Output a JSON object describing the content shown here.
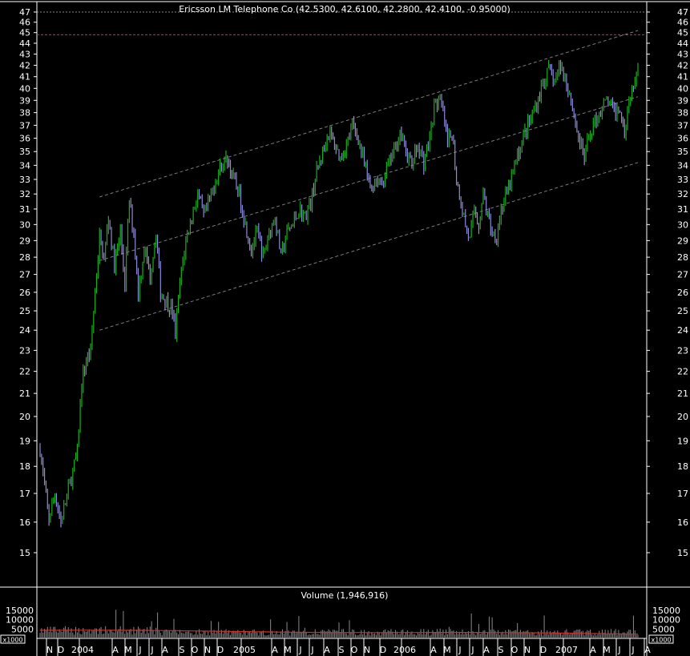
{
  "chart_data": {
    "type": "ohlc",
    "title": "Ericsson LM Telephone Co (42.5300, 42.6100, 42.2800, 42.4100, -0.95000)",
    "volume_title": "Volume (1,946,916)",
    "volume_unit_label": "x1000",
    "ylim": [
      14,
      47.5
    ],
    "y_ticks": [
      15,
      16,
      17,
      18,
      19,
      20,
      21,
      22,
      23,
      24,
      25,
      26,
      27,
      28,
      29,
      30,
      31,
      32,
      33,
      34,
      35,
      36,
      37,
      38,
      39,
      40,
      41,
      42,
      43,
      44,
      45,
      46,
      47
    ],
    "volume_ylim": [
      0,
      20000
    ],
    "volume_ticks": [
      5000,
      10000,
      15000
    ],
    "grid": false,
    "x_labels": [
      "N",
      "D",
      "2004",
      "A",
      "M",
      "J",
      "J",
      "A",
      "S",
      "O",
      "N",
      "D",
      "2005",
      "A",
      "M",
      "J",
      "J",
      "A",
      "S",
      "O",
      "N",
      "D",
      "2006",
      "A",
      "M",
      "J",
      "J",
      "A",
      "S",
      "O",
      "N",
      "D",
      "2007",
      "A",
      "M",
      "J",
      "J",
      "A"
    ],
    "reference_line": 44.8,
    "price_path": [
      [
        0,
        18.7
      ],
      [
        3,
        17.2
      ],
      [
        6,
        16.1
      ],
      [
        10,
        17.0
      ],
      [
        14,
        16.0
      ],
      [
        18,
        16.9
      ],
      [
        22,
        17.8
      ],
      [
        25,
        18.5
      ],
      [
        28,
        21.5
      ],
      [
        31,
        22.5
      ],
      [
        34,
        23.0
      ],
      [
        37,
        26.0
      ],
      [
        40,
        29.2
      ],
      [
        43,
        27.8
      ],
      [
        46,
        30.5
      ],
      [
        50,
        27.5
      ],
      [
        54,
        29.5
      ],
      [
        57,
        26.5
      ],
      [
        60,
        31.5
      ],
      [
        63,
        29.5
      ],
      [
        66,
        26.0
      ],
      [
        70,
        28.5
      ],
      [
        74,
        27.0
      ],
      [
        78,
        29.5
      ],
      [
        81,
        26.0
      ],
      [
        85,
        25.5
      ],
      [
        89,
        25.0
      ],
      [
        91,
        23.8
      ],
      [
        94,
        26.5
      ],
      [
        98,
        29.0
      ],
      [
        102,
        30.5
      ],
      [
        106,
        32.0
      ],
      [
        110,
        30.5
      ],
      [
        114,
        31.5
      ],
      [
        118,
        33.0
      ],
      [
        122,
        34.0
      ],
      [
        126,
        34.5
      ],
      [
        130,
        33.0
      ],
      [
        134,
        32.0
      ],
      [
        138,
        30.0
      ],
      [
        142,
        28.5
      ],
      [
        146,
        29.5
      ],
      [
        150,
        28.0
      ],
      [
        154,
        29.5
      ],
      [
        158,
        30.5
      ],
      [
        162,
        28.0
      ],
      [
        166,
        29.5
      ],
      [
        170,
        30.0
      ],
      [
        174,
        31.0
      ],
      [
        178,
        30.5
      ],
      [
        182,
        31.5
      ],
      [
        186,
        33.5
      ],
      [
        190,
        35.0
      ],
      [
        194,
        36.5
      ],
      [
        198,
        35.5
      ],
      [
        202,
        34.5
      ],
      [
        206,
        35.5
      ],
      [
        210,
        37.0
      ],
      [
        214,
        36.0
      ],
      [
        218,
        34.0
      ],
      [
        222,
        32.5
      ],
      [
        226,
        33.0
      ],
      [
        230,
        32.8
      ],
      [
        234,
        34.0
      ],
      [
        238,
        35.0
      ],
      [
        242,
        36.5
      ],
      [
        246,
        35.0
      ],
      [
        250,
        34.0
      ],
      [
        254,
        35.5
      ],
      [
        258,
        34.2
      ],
      [
        262,
        36.0
      ],
      [
        265,
        38.5
      ],
      [
        268,
        39.0
      ],
      [
        271,
        38.0
      ],
      [
        274,
        35.5
      ],
      [
        277,
        36.5
      ],
      [
        280,
        33.0
      ],
      [
        283,
        31.5
      ],
      [
        286,
        30.0
      ],
      [
        289,
        29.0
      ],
      [
        292,
        31.0
      ],
      [
        295,
        30.0
      ],
      [
        298,
        32.0
      ],
      [
        301,
        30.5
      ],
      [
        304,
        29.5
      ],
      [
        307,
        29.3
      ],
      [
        310,
        31.0
      ],
      [
        314,
        32.0
      ],
      [
        318,
        33.5
      ],
      [
        322,
        35.0
      ],
      [
        326,
        36.5
      ],
      [
        330,
        37.5
      ],
      [
        334,
        38.8
      ],
      [
        338,
        40.5
      ],
      [
        342,
        41.5
      ],
      [
        346,
        40.5
      ],
      [
        350,
        42.0
      ],
      [
        354,
        40.5
      ],
      [
        358,
        38.5
      ],
      [
        362,
        36.0
      ],
      [
        366,
        34.5
      ],
      [
        370,
        36.5
      ],
      [
        374,
        37.5
      ],
      [
        378,
        38.5
      ],
      [
        382,
        39.0
      ],
      [
        386,
        38.0
      ],
      [
        390,
        38.5
      ],
      [
        393,
        36.5
      ],
      [
        396,
        39.0
      ],
      [
        399,
        40.5
      ],
      [
        402,
        42.4
      ]
    ],
    "channel": {
      "upper": [
        [
          40,
          31.8
        ],
        [
          402,
          45.2
        ]
      ],
      "middle": [
        [
          40,
          27.8
        ],
        [
          402,
          39.3
        ]
      ],
      "lower": [
        [
          40,
          24.0
        ],
        [
          402,
          34.2
        ]
      ]
    }
  }
}
